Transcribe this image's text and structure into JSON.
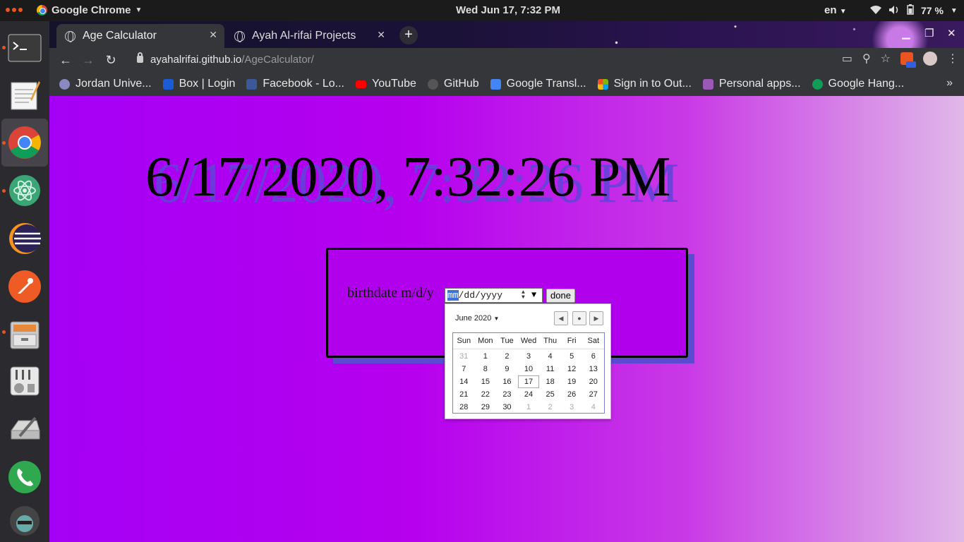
{
  "system": {
    "app_name": "Google Chrome",
    "clock": "Wed Jun 17,  7:32 PM",
    "language": "en",
    "battery": "77 %"
  },
  "dock": {
    "items": [
      "terminal",
      "text-editor",
      "chrome",
      "atom",
      "eclipse",
      "postman",
      "archive-manager",
      "mixer",
      "disks",
      "phone",
      "avatar"
    ]
  },
  "browser": {
    "tabs": [
      {
        "title": "Age Calculator",
        "active": true
      },
      {
        "title": "Ayah Al-rifai Projects",
        "active": false
      }
    ],
    "url_host": "ayahalrifai.github.io",
    "url_path": "/AgeCalculator/",
    "bookmarks": [
      {
        "label": "Jordan Unive...",
        "icon_color": "#8a8ac0"
      },
      {
        "label": "Box | Login",
        "icon_color": "#1a5bd6"
      },
      {
        "label": "Facebook - Lo...",
        "icon_color": "#3b5998"
      },
      {
        "label": "YouTube",
        "icon_color": "#ff0000"
      },
      {
        "label": "GitHub",
        "icon_color": "#555555"
      },
      {
        "label": "Google Transl...",
        "icon_color": "#4285f4"
      },
      {
        "label": "Sign in to Out...",
        "icon_color": "#f25022"
      },
      {
        "label": "Personal apps...",
        "icon_color": "#9b59b6"
      },
      {
        "label": "Google Hang...",
        "icon_color": "#0f9d58"
      }
    ]
  },
  "page": {
    "datetime": "6/17/2020, 7:32:26 PM",
    "birthdate_label": "birthdate m/d/y",
    "date_input": {
      "mm": "mm",
      "rest": "/dd/yyyy"
    },
    "done_label": "done",
    "calendar": {
      "month_label": "June 2020",
      "weekdays": [
        "Sun",
        "Mon",
        "Tue",
        "Wed",
        "Thu",
        "Fri",
        "Sat"
      ],
      "weeks": [
        [
          "31",
          "1",
          "2",
          "3",
          "4",
          "5",
          "6"
        ],
        [
          "7",
          "8",
          "9",
          "10",
          "11",
          "12",
          "13"
        ],
        [
          "14",
          "15",
          "16",
          "17",
          "18",
          "19",
          "20"
        ],
        [
          "21",
          "22",
          "23",
          "24",
          "25",
          "26",
          "27"
        ],
        [
          "28",
          "29",
          "30",
          "1",
          "2",
          "3",
          "4"
        ]
      ],
      "today": "17"
    }
  },
  "colors": {
    "page_gradient_start": "#a500f5",
    "page_gradient_end": "#e0b8e8",
    "card_shadow": "#5a4bd0"
  }
}
